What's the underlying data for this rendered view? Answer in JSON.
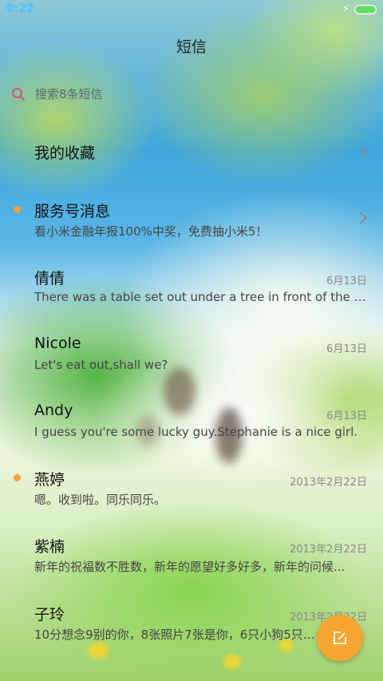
{
  "status_bar": {
    "time": "0:22",
    "charging_icon": "lightning-icon",
    "battery_level": 1.0,
    "battery_color": "#5ee05e"
  },
  "header": {
    "title": "短信"
  },
  "search": {
    "placeholder": "搜索8条短信",
    "icon": "search-icon",
    "icon_color": "#e0457a"
  },
  "items": [
    {
      "name": "我的收藏",
      "preview": "",
      "date": "",
      "unread": false,
      "chevron": true
    },
    {
      "name": "服务号消息",
      "preview": "看小米金融年报100%中奖，免费抽小米5！",
      "date": "",
      "unread": true,
      "chevron": true
    },
    {
      "name": "倩倩",
      "preview": "There was a table set out under a tree in front of the house...",
      "date": "6月13日",
      "unread": false
    },
    {
      "name": "Nicole",
      "preview": "Let's eat out,shall we?",
      "date": "6月13日",
      "unread": false
    },
    {
      "name": "Andy",
      "preview": "I guess you're some lucky guy.Stephanie is a nice girl.",
      "date": "6月13日",
      "unread": false
    },
    {
      "name": "燕婷",
      "preview": "嗯。收到啦。同乐同乐。",
      "date": "2013年2月22日",
      "unread": true
    },
    {
      "name": "紫楠",
      "preview": "新年的祝福数不胜数，新年的愿望好多好多，新年的问候...",
      "date": "2013年2月22日",
      "unread": false
    },
    {
      "name": "子玲",
      "preview": "10分想念9别的你，8张照片7张是你，6只小狗5只像你...",
      "date": "2013年2月22日",
      "unread": false
    }
  ],
  "fab": {
    "icon": "compose-icon",
    "color": "#f7a530"
  },
  "colors": {
    "unread_dot": "#f5a03a",
    "accent_time": "#4fc3f7"
  }
}
